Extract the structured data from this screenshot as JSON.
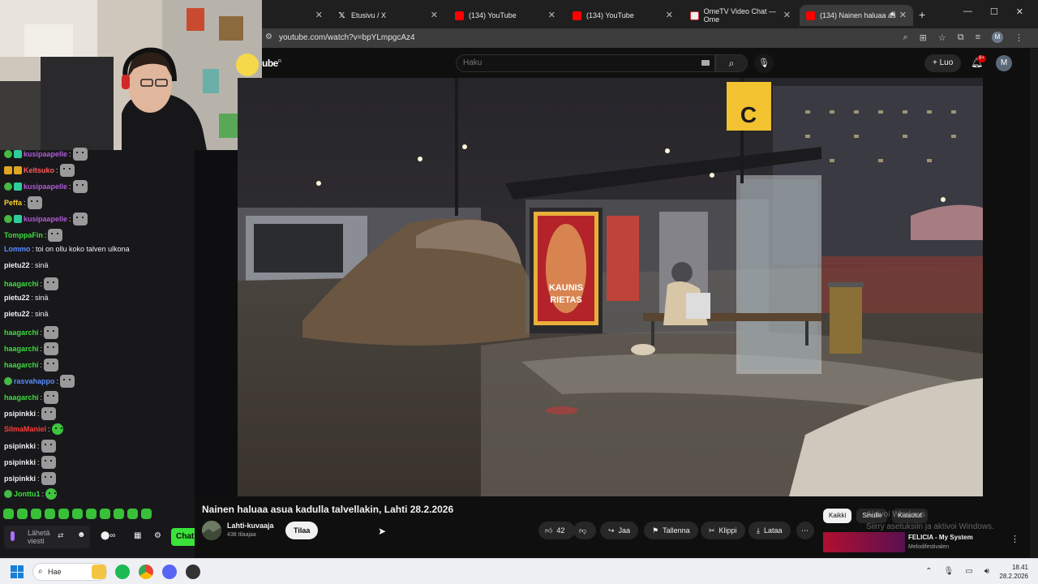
{
  "browser": {
    "tabs": [
      {
        "label": "",
        "icon": "blank"
      },
      {
        "label": "Etusivu / X",
        "icon": "x-icon"
      },
      {
        "label": "(134) YouTube",
        "icon": "youtube-icon"
      },
      {
        "label": "(134) YouTube",
        "icon": "youtube-icon"
      },
      {
        "label": "OmeTV Video Chat — Ome",
        "icon": "ometv-icon"
      },
      {
        "label": "(134) Nainen haluaa as",
        "icon": "youtube-icon"
      }
    ],
    "url": "youtube.com/watch?v=bpYLmpgcAz4",
    "profile_initial": "M"
  },
  "youtube": {
    "logo_text": "ube",
    "logo_sup": "FI",
    "search_placeholder": "Haku",
    "create_label": "Luo",
    "notif_badge": "9+",
    "avatar_initial": "M",
    "video": {
      "poster_line1": "KAUNIS",
      "poster_line2": "RIETAS",
      "platform_sign": "C"
    },
    "title": "Nainen haluaa asua kadulla talvellakin, Lahti 28.2.2026",
    "channel": {
      "name": "Lahti-kuvaaja",
      "subscribers": "438 tilaajaa"
    },
    "subscribe_label": "Tilaa",
    "actions": {
      "likes": "42",
      "share": "Jaa",
      "save": "Tallenna",
      "clip": "Klippi",
      "download": "Lataa"
    },
    "chips": [
      "Kaikki",
      "Sinulle",
      "Katsotut"
    ],
    "recommended": {
      "title": "FELICIA - My System",
      "channel": "Melodifestivalen"
    }
  },
  "windows_watermark": {
    "line1": "Aktivoi Windows",
    "line2": "Siirry asetuksiin ja aktivoi Windows."
  },
  "chat": {
    "messages": [
      {
        "user": "kusipaapelle",
        "text": "",
        "color": "#b05bd6",
        "badges": [
          "green",
          "teal"
        ],
        "emote": "cat"
      },
      {
        "user": "Keltsuko",
        "text": "",
        "color": "#ff5a5a",
        "badges": [
          "gold",
          "gold"
        ],
        "emote": "cat"
      },
      {
        "user": "kusipaapelle",
        "text": "",
        "color": "#b05bd6",
        "badges": [
          "green",
          "teal"
        ],
        "emote": "cat"
      },
      {
        "user": "Peffa",
        "text": "",
        "color": "#ffd12e",
        "badges": [],
        "emote": "cat"
      },
      {
        "user": "kusipaapelle",
        "text": "",
        "color": "#b05bd6",
        "badges": [
          "green",
          "teal"
        ],
        "emote": "cat"
      },
      {
        "user": "TomppaFin",
        "text": "",
        "color": "#3edc3e",
        "badges": [],
        "emote": "cat"
      },
      {
        "user": "Lommo",
        "text": "toi on ollu koko talven ulkona",
        "color": "#5b8cff",
        "badges": [],
        "emote": ""
      },
      {
        "user": "pietu22",
        "text": "sinä",
        "color": "#efeff1",
        "badges": [],
        "emote": ""
      },
      {
        "user": "haagarchi",
        "text": "",
        "color": "#3edc3e",
        "badges": [],
        "emote": "cat"
      },
      {
        "user": "pietu22",
        "text": "sinä",
        "color": "#efeff1",
        "badges": [],
        "emote": ""
      },
      {
        "user": "pietu22",
        "text": "sinä",
        "color": "#efeff1",
        "badges": [],
        "emote": ""
      },
      {
        "user": "haagarchi",
        "text": "",
        "color": "#3edc3e",
        "badges": [],
        "emote": "cat"
      },
      {
        "user": "haagarchi",
        "text": "",
        "color": "#3edc3e",
        "badges": [],
        "emote": "cat"
      },
      {
        "user": "haagarchi",
        "text": "",
        "color": "#3edc3e",
        "badges": [],
        "emote": "cat"
      },
      {
        "user": "rasvahappo",
        "text": "",
        "color": "#5b8cff",
        "badges": [
          "green"
        ],
        "emote": "cat"
      },
      {
        "user": "haagarchi",
        "text": "",
        "color": "#3edc3e",
        "badges": [],
        "emote": "cat"
      },
      {
        "user": "psipinkki",
        "text": "",
        "color": "#efeff1",
        "badges": [],
        "emote": "cat"
      },
      {
        "user": "SilmaManiel",
        "text": "",
        "color": "#ff3b3b",
        "badges": [],
        "emote": "green"
      },
      {
        "user": "psipinkki",
        "text": "",
        "color": "#efeff1",
        "badges": [],
        "emote": "cat"
      },
      {
        "user": "psipinkki",
        "text": "",
        "color": "#efeff1",
        "badges": [],
        "emote": "cat"
      },
      {
        "user": "psipinkki",
        "text": "",
        "color": "#efeff1",
        "badges": [],
        "emote": "cat"
      },
      {
        "user": "Jonttu1",
        "text": "",
        "color": "#3edc3e",
        "badges": [
          "green"
        ],
        "emote": "green"
      }
    ],
    "input_placeholder": "Lähetä viesti",
    "send_label": "Chat"
  },
  "taskbar": {
    "search_label": "Hae",
    "time": "18.41",
    "date": "28.2.2026"
  }
}
